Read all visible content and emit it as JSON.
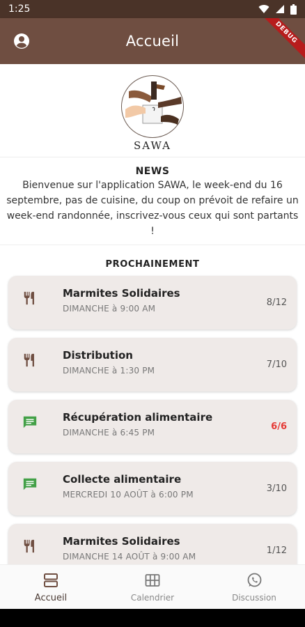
{
  "status": {
    "time": "1:25"
  },
  "appbar": {
    "title": "Accueil",
    "debug_label": "DEBUG"
  },
  "logo": {
    "text": "SAWA"
  },
  "news": {
    "title": "NEWS",
    "body": "Bienvenue sur l'application SAWA, le week-end du 16 septembre, pas de cuisine, du coup on prévoit de refaire un week-end randonnée, inscrivez-vous ceux qui sont partants !"
  },
  "upcoming": {
    "title": "PROCHAINEMENT",
    "events": [
      {
        "name": "Marmites Solidaires",
        "date": "DIMANCHE à 9:00 AM",
        "count": "8/12",
        "icon": "restaurant-icon"
      },
      {
        "name": "Distribution",
        "date": "DIMANCHE à 1:30 PM",
        "count": "7/10",
        "icon": "restaurant-icon"
      },
      {
        "name": "Récupération alimentaire",
        "date": "DIMANCHE à 6:45 PM",
        "count": "6/6",
        "icon": "chat-icon"
      },
      {
        "name": "Collecte alimentaire",
        "date": "MERCREDI 10 AOÛT à 6:00 PM",
        "count": "3/10",
        "icon": "chat-icon"
      },
      {
        "name": "Marmites Solidaires",
        "date": "DIMANCHE 14 AOÛT à 9:00 AM",
        "count": "1/12",
        "icon": "restaurant-icon"
      }
    ]
  },
  "bottom_nav": {
    "items": [
      {
        "label": "Accueil"
      },
      {
        "label": "Calendrier"
      },
      {
        "label": "Discussion"
      }
    ]
  },
  "colors": {
    "appbar": "#6f4e41",
    "statusbar": "#4a3328",
    "card": "#efeae8",
    "icon_brown": "#6f4e41",
    "icon_green": "#43a047",
    "full_count": "#e53935"
  }
}
